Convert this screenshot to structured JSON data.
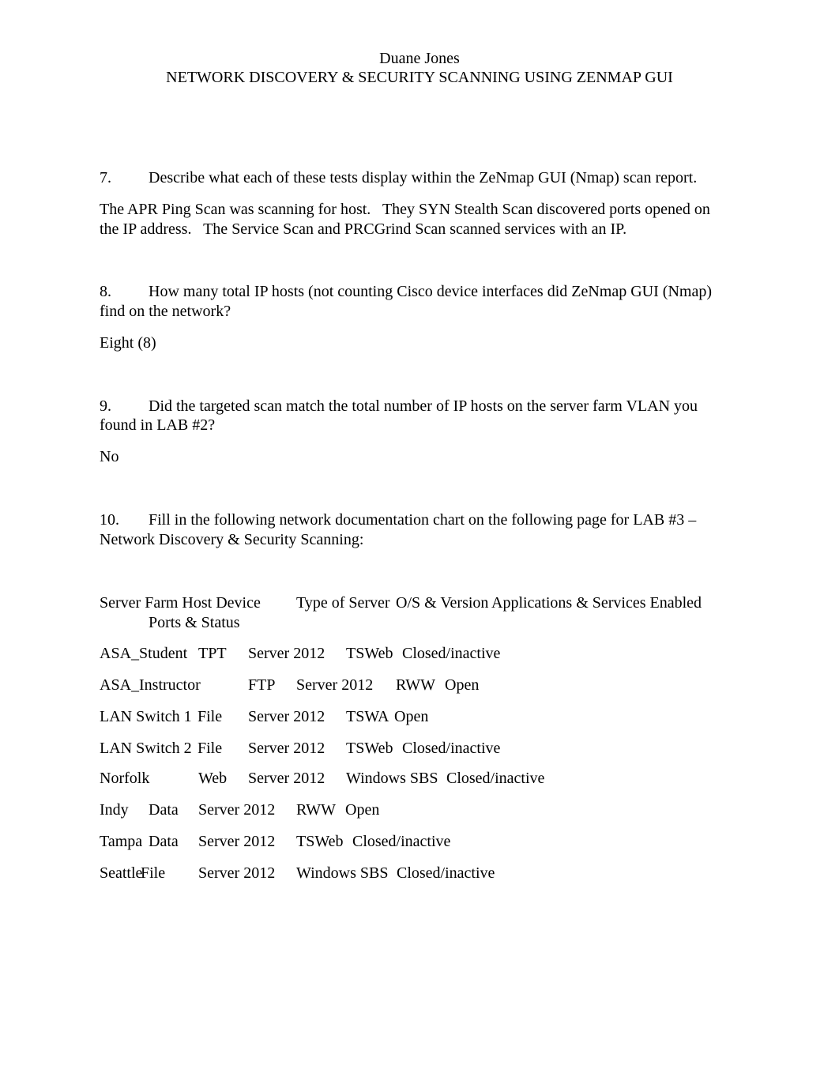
{
  "header": {
    "author": "Duane Jones",
    "title": "NETWORK DISCOVERY & SECURITY SCANNING USING ZENMAP GUI"
  },
  "questions": [
    {
      "number": "7.",
      "question_lines": [
        "Describe what each of these tests display within the ZeNmap GUI (Nmap) scan report."
      ],
      "answer_lines": [
        "The APR Ping Scan was scanning for host.   They SYN Stealth Scan discovered ports opened on",
        "the IP address.   The Service Scan and PRCGrind Scan scanned services with an IP."
      ]
    },
    {
      "number": "8.",
      "question_lines": [
        "How many total IP hosts (not counting Cisco device interfaces did ZeNmap GUI (Nmap)",
        "find on the network?"
      ],
      "answer_lines": [
        "Eight (8)"
      ]
    },
    {
      "number": "9.",
      "question_lines": [
        "Did the targeted scan match the total number of IP hosts on the server farm VLAN you",
        "found in LAB #2?"
      ],
      "answer_lines": [
        "No"
      ]
    },
    {
      "number": "10.",
      "question_lines": [
        "Fill in the following network documentation chart on the following page for LAB #3 –",
        "Network Discovery & Security Scanning:"
      ],
      "answer_lines": []
    }
  ],
  "chart": {
    "headers": {
      "host_device": "Server Farm Host Device",
      "type": "Type of Server",
      "os": "O/S & Version",
      "apps": "Applications & Services Enabled",
      "ports": "Ports & Status"
    },
    "rows": [
      {
        "host": "ASA_Student",
        "type": "TPT",
        "os": "Server 2012",
        "app": "TSWeb",
        "status": "Closed/inactive"
      },
      {
        "host": "ASA_Instructor",
        "type": "FTP",
        "os": "Server 2012",
        "app": "RWW",
        "status": "Open"
      },
      {
        "host": "LAN Switch 1",
        "type": "File",
        "os": "Server 2012",
        "app": "TSWA",
        "status": "Open"
      },
      {
        "host": "LAN Switch 2",
        "type": "File",
        "os": "Server 2012",
        "app": "TSWeb",
        "status": "Closed/inactive"
      },
      {
        "host": "Norfolk",
        "type": "Web",
        "os": "Server 2012",
        "app": "Windows SBS",
        "status": "Closed/inactive"
      },
      {
        "host": "Indy",
        "type": "Data",
        "os": "Server 2012",
        "app": "RWW",
        "status": "Open"
      },
      {
        "host": "Tampa",
        "type": "Data",
        "os": "Server 2012",
        "app": "TSWeb",
        "status": "Closed/inactive"
      },
      {
        "host": "Seattle",
        "type": "File",
        "os": "Server 2012",
        "app": "Windows SBS",
        "status": "Closed/inactive"
      }
    ]
  }
}
